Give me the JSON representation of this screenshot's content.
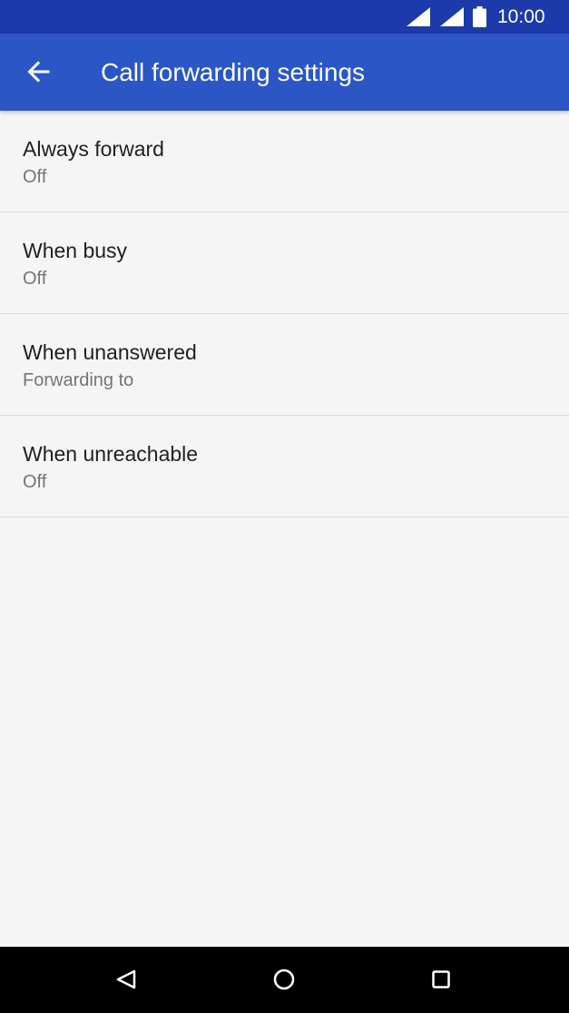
{
  "status_bar": {
    "time": "10:00",
    "icons": [
      "cell-signal-icon",
      "cell-signal-icon",
      "battery-icon"
    ]
  },
  "app_bar": {
    "title": "Call forwarding settings",
    "back_icon": "arrow-back-icon",
    "color": "#2a56c6"
  },
  "list": {
    "items": [
      {
        "title": "Always forward",
        "summary": "Off"
      },
      {
        "title": "When busy",
        "summary": "Off"
      },
      {
        "title": "When unanswered",
        "summary": "Forwarding to"
      },
      {
        "title": "When unreachable",
        "summary": "Off"
      }
    ]
  },
  "nav_bar": {
    "icons": [
      "nav-back-icon",
      "nav-home-icon",
      "nav-recents-icon"
    ]
  },
  "colors": {
    "status_bar": "#1c3aa9",
    "app_bar": "#2a56c6",
    "background": "#f5f5f5",
    "title_text": "#212121",
    "summary_text": "#757575"
  }
}
